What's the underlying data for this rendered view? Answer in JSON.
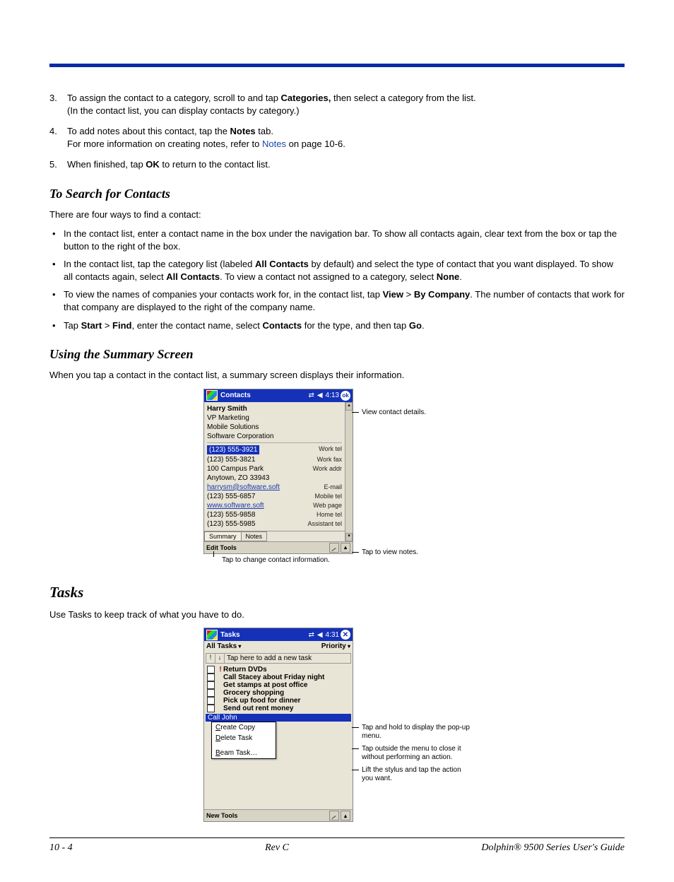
{
  "steps": {
    "s3a": "To assign the contact to a category, scroll to and tap ",
    "s3b": "Categories,",
    "s3c": " then select a category from the list.",
    "s3d": "(In the contact list, you can display contacts by category.)",
    "s4a": "To add notes about this contact, tap the ",
    "s4b": "Notes",
    "s4c": " tab.",
    "s4d": "For more information on creating notes, refer to ",
    "s4e": "Notes",
    "s4f": " on page 10-6.",
    "s5a": "When finished, tap ",
    "s5b": "OK",
    "s5c": " to return to the contact list."
  },
  "h": {
    "search": "To Search for Contacts",
    "summary": "Using the Summary Screen",
    "tasks": "Tasks"
  },
  "p": {
    "fourways": "There are four ways to find a contact:",
    "summ": "When you tap a contact in the contact list, a summary screen displays their information.",
    "tasks": "Use Tasks to keep track of what you have to do."
  },
  "bul": {
    "b1": "In the contact list, enter a contact name in the box under the navigation bar. To show all contacts again, clear text from the box or tap the button to the right of the box.",
    "b2a": "In the contact list, tap the category list (labeled ",
    "b2b": "All Contacts",
    "b2c": " by default) and select the type of contact that you want displayed. To show all contacts again, select ",
    "b2d": "All Contacts",
    "b2e": ". To view a contact not assigned to a category, select ",
    "b2f": "None",
    "b2g": ".",
    "b3a": "To view the names of companies your contacts work for, in the contact list, tap ",
    "b3b": "View",
    "b3c": " > ",
    "b3d": "By Company",
    "b3e": ". The number of contacts that work for that company are displayed to the right of the company name.",
    "b4a": "Tap ",
    "b4b": "Start",
    "b4c": " > ",
    "b4d": "Find",
    "b4e": ", enter the contact name, select ",
    "b4f": "Contacts",
    "b4g": " for the type, and then tap ",
    "b4h": "Go",
    "b4i": "."
  },
  "fig1": {
    "title": "Contacts",
    "time": "4:13",
    "ok": "ok",
    "name": "Harry Smith",
    "role": "VP Marketing",
    "co1": "Mobile Solutions",
    "co2": "Software Corporation",
    "r1l": "(123) 555-3921",
    "r1r": "Work tel",
    "r2l": "(123) 555-3821",
    "r2r": "Work fax",
    "r3l": "100 Campus Park",
    "r3r": "Work addr",
    "r3l2": "Anytown, ZO 33943",
    "r4l": "harrysm@software.soft",
    "r4r": "E-mail",
    "r5l": "(123) 555-6857",
    "r5r": "Mobile tel",
    "r6l": "www.software.soft",
    "r6r": "Web page",
    "r7l": "(123) 555-9858",
    "r7r": "Home tel",
    "r8l": "(123) 555-5985",
    "r8r": "Assistant tel",
    "tab1": "Summary",
    "tab2": "Notes",
    "menu": "Edit  Tools",
    "co_a": "View contact details.",
    "co_b": "Tap to view notes.",
    "co_c": "Tap to change contact information."
  },
  "fig2": {
    "title": "Tasks",
    "time": "4:31",
    "hdr_l": "All Tasks",
    "hdr_r": "Priority",
    "add": "Tap here to add a new task",
    "t1": "Return DVDs",
    "t2": "Call Stacey about Friday night",
    "t3": "Get stamps at post office",
    "t4": "Grocery shopping",
    "t5": "Pick up food for dinner",
    "t6": "Send out rent money",
    "t7": "Call John",
    "m1a": "C",
    "m1b": "reate Copy",
    "m2a": "D",
    "m2b": "elete Task",
    "m3a": "B",
    "m3b": "eam Task…",
    "menu": "New  Tools",
    "co_a": "Tap and hold to display the pop-up menu.",
    "co_b": "Tap outside the menu to close it without performing an action.",
    "co_c": "Lift the stylus and tap the action you want."
  },
  "footer": {
    "l": "10 - 4",
    "c": "Rev C",
    "r": "Dolphin® 9500 Series User's Guide"
  }
}
